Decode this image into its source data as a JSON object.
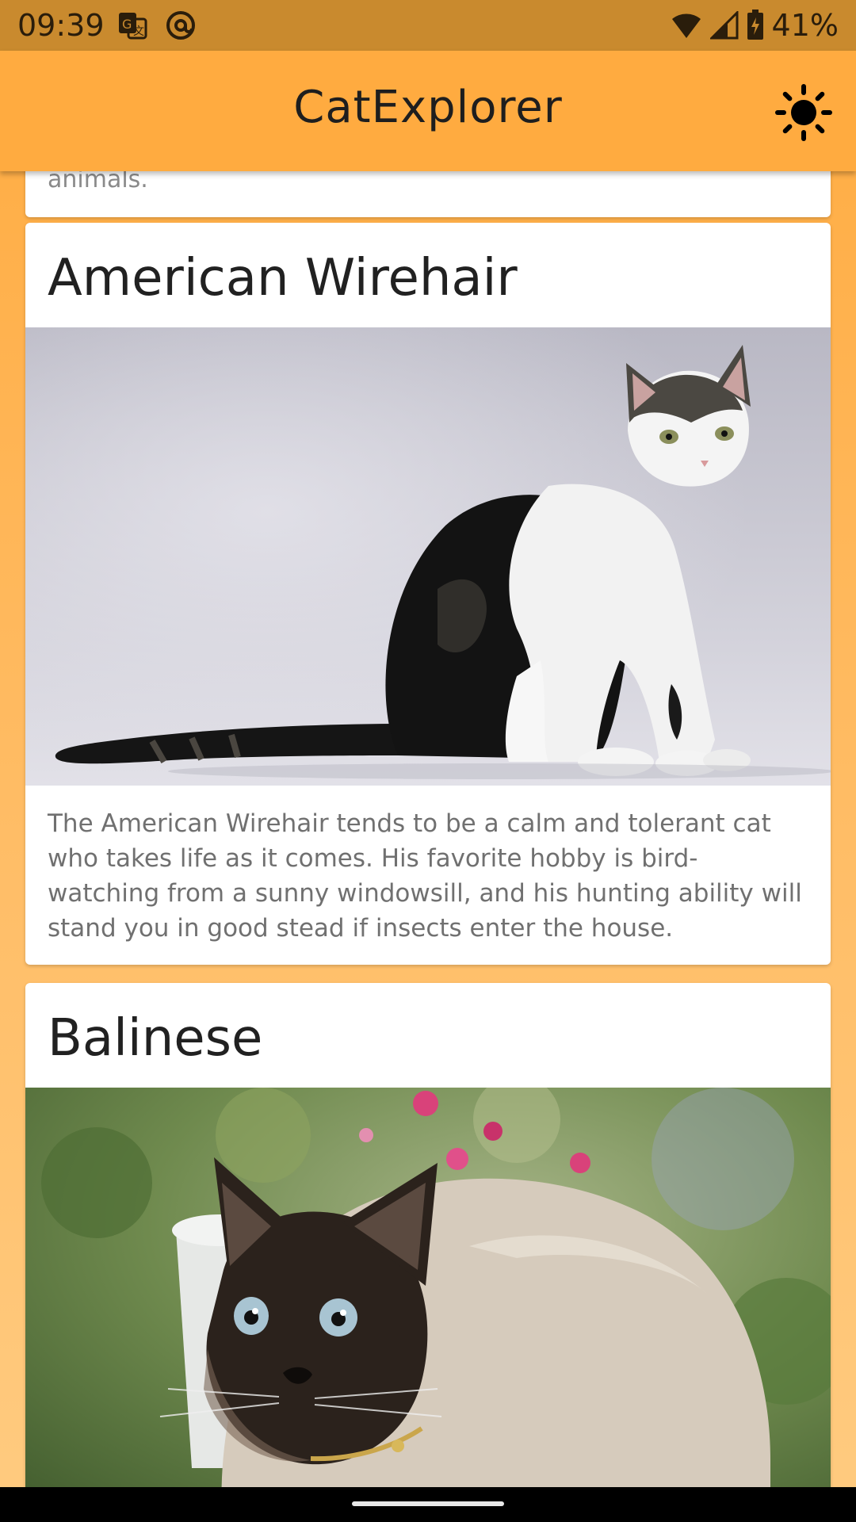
{
  "status_bar": {
    "time": "09:39",
    "battery": "41%",
    "icons": [
      "translate-icon",
      "at-sign-icon",
      "wifi-icon",
      "signal-icon",
      "battery-icon"
    ]
  },
  "app_bar": {
    "title": "CatExplorer",
    "theme_icon": "sun-icon"
  },
  "cards": [
    {
      "snippet": "animals."
    },
    {
      "title": "American Wirehair",
      "description": "The American Wirehair tends to be a calm and tolerant cat who takes life as it comes. His favorite hobby is bird-watching from a sunny windowsill, and his hunting ability will stand you in good stead if insects enter the house."
    },
    {
      "title": "Balinese"
    }
  ],
  "colors": {
    "primary": "#ffab40",
    "status_bar": "#c98a2e",
    "card": "#ffffff",
    "title_text": "#212121",
    "body_text": "#707070"
  }
}
